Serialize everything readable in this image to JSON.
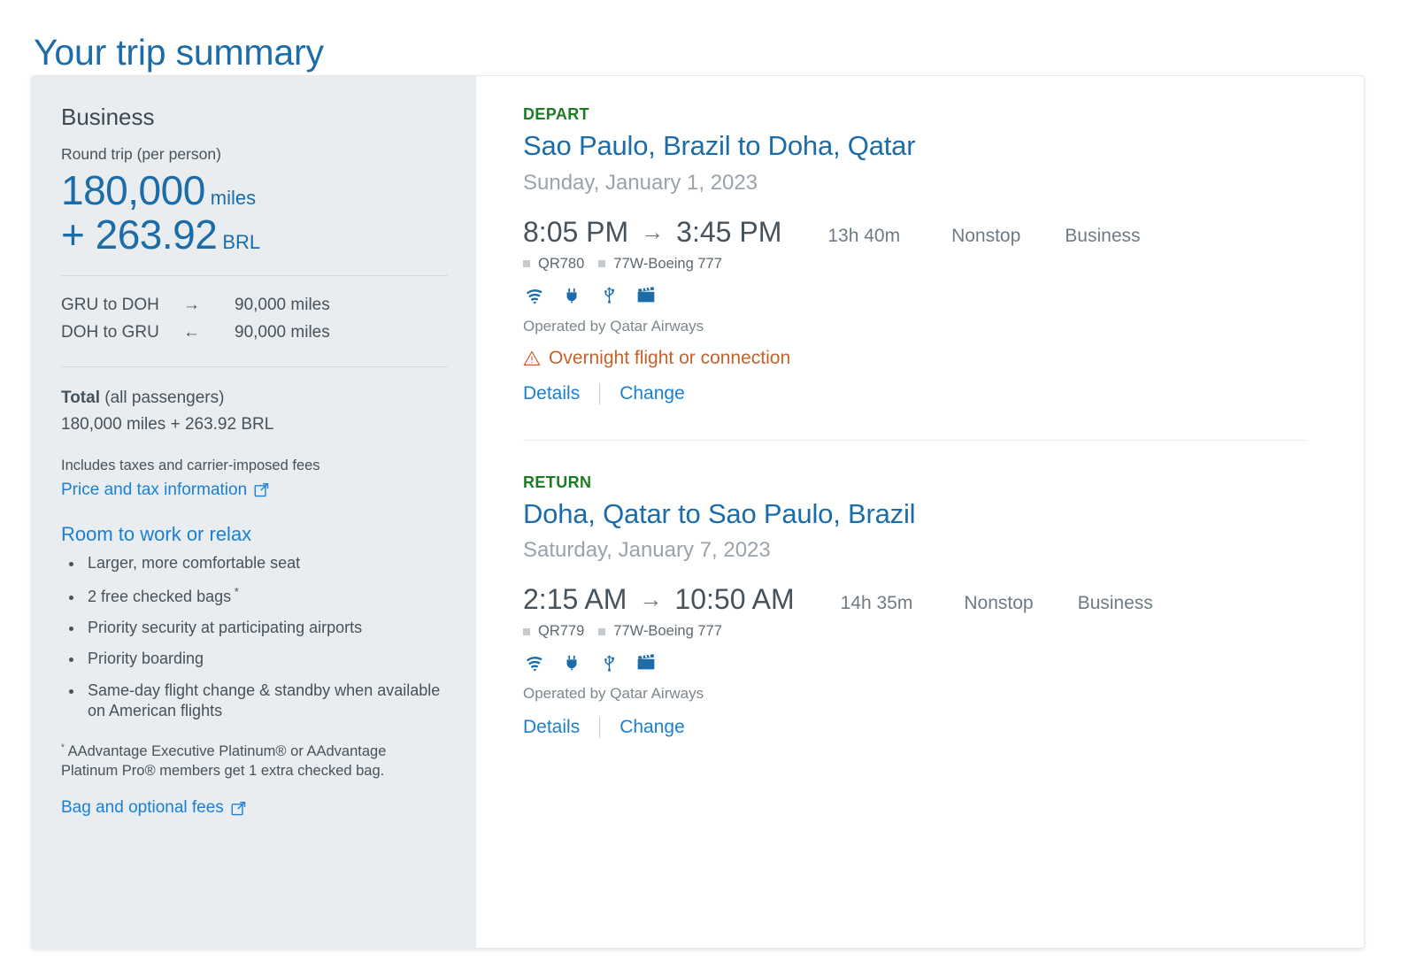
{
  "page": {
    "title": "Your trip summary"
  },
  "summary": {
    "cabin": "Business",
    "per_person_label": "Round trip (per person)",
    "miles_amount": "180,000",
    "miles_unit": "miles",
    "cash_amount": "+ 263.92",
    "cash_unit": "BRL",
    "legs": [
      {
        "route": "GRU to DOH",
        "arrow": "→",
        "miles": "90,000 miles"
      },
      {
        "route": "DOH to GRU",
        "arrow": "←",
        "miles": "90,000 miles"
      }
    ],
    "total_label": "Total",
    "total_sub": " (all passengers)",
    "total_value": "180,000 miles + 263.92 BRL",
    "includes_note": "Includes taxes and carrier-imposed fees",
    "price_tax_link": "Price and tax information",
    "benefits_title": "Room to work or relax",
    "benefits": [
      "Larger, more comfortable seat",
      "2 free checked bags",
      "Priority security at participating airports",
      "Priority boarding",
      "Same-day flight change & standby when available on American flights"
    ],
    "benefit_star_index": 1,
    "footnote": "AAdvantage Executive Platinum® or AAdvantage Platinum Pro® members get 1 extra checked bag.",
    "bag_fees_link": "Bag and optional fees"
  },
  "itinerary": {
    "segments": [
      {
        "kicker": "DEPART",
        "route": "Sao Paulo, Brazil to Doha, Qatar",
        "date": "Sunday, January 1, 2023",
        "depart_time": "8:05 PM",
        "arrive_time": "3:45 PM",
        "arrow": "→",
        "duration": "13h 40m",
        "stops": "Nonstop",
        "cabin": "Business",
        "flight_number": "QR780",
        "aircraft": "77W-Boeing 777",
        "amenities": [
          "wifi-icon",
          "power-outlet-icon",
          "usb-icon",
          "entertainment-icon"
        ],
        "operated_by": "Operated by Qatar Airways",
        "alert": "Overnight flight or connection",
        "details_label": "Details",
        "change_label": "Change"
      },
      {
        "kicker": "RETURN",
        "route": "Doha, Qatar to Sao Paulo, Brazil",
        "date": "Saturday, January 7, 2023",
        "depart_time": "2:15 AM",
        "arrive_time": "10:50 AM",
        "arrow": "→",
        "duration": "14h 35m",
        "stops": "Nonstop",
        "cabin": "Business",
        "flight_number": "QR779",
        "aircraft": "77W-Boeing 777",
        "amenities": [
          "wifi-icon",
          "power-outlet-icon",
          "usb-icon",
          "entertainment-icon"
        ],
        "operated_by": "Operated by Qatar Airways",
        "alert": null,
        "details_label": "Details",
        "change_label": "Change"
      }
    ]
  },
  "colors": {
    "brand_blue": "#1b6ca8",
    "link_blue": "#1b7fd4",
    "kicker_green": "#1f7a25",
    "alert_orange": "#c4622d",
    "panel_bg": "#e9edef",
    "body_text": "#46525c"
  }
}
